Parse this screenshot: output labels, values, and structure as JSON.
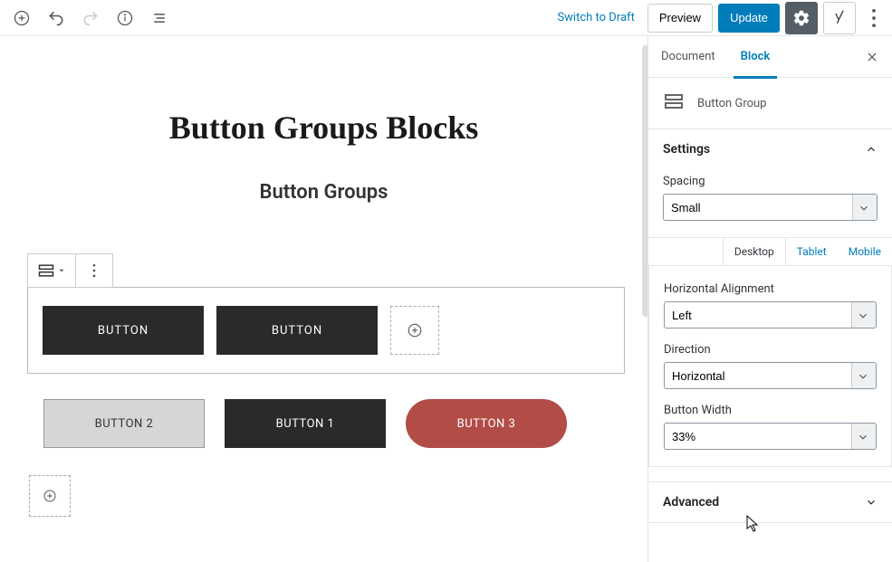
{
  "toolbar": {
    "switch_draft": "Switch to Draft",
    "preview": "Preview",
    "update": "Update"
  },
  "sidebar": {
    "tabs": {
      "document": "Document",
      "block": "Block"
    },
    "block_name": "Button Group",
    "settings_title": "Settings",
    "spacing_label": "Spacing",
    "spacing_value": "Small",
    "responsive": {
      "desktop": "Desktop",
      "tablet": "Tablet",
      "mobile": "Mobile"
    },
    "halign_label": "Horizontal Alignment",
    "halign_value": "Left",
    "direction_label": "Direction",
    "direction_value": "Horizontal",
    "bwidth_label": "Button Width",
    "bwidth_value": "33%",
    "advanced_title": "Advanced"
  },
  "content": {
    "title": "Button Groups Blocks",
    "subtitle": "Button Groups",
    "group1": {
      "b1": "BUTTON",
      "b2": "BUTTON"
    },
    "row2": {
      "b1": "BUTTON 2",
      "b2": "BUTTON 1",
      "b3": "BUTTON 3"
    }
  }
}
